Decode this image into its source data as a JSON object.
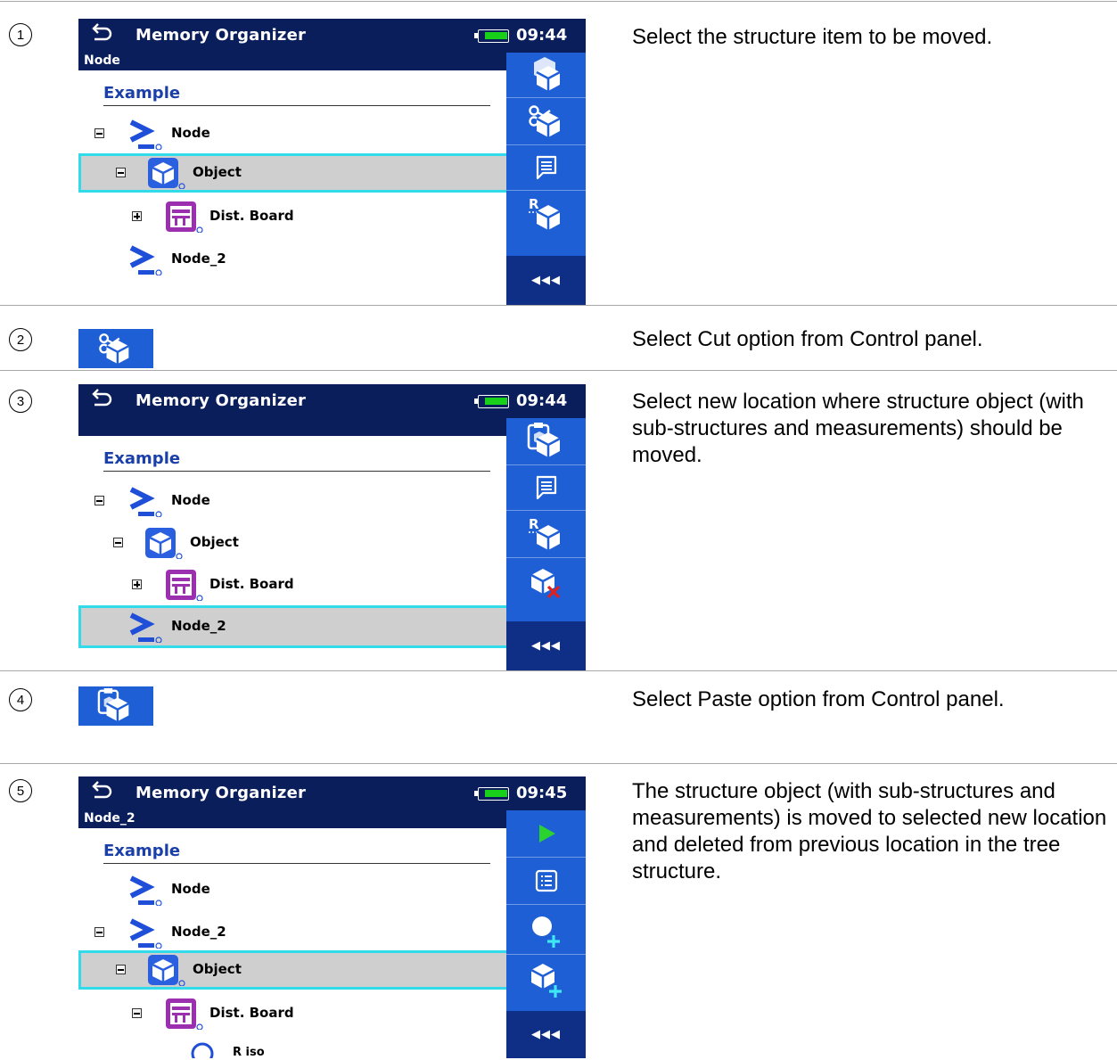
{
  "step_numbers": [
    "1",
    "2",
    "3",
    "4",
    "5"
  ],
  "descriptions": [
    "Select the structure item to be moved.",
    "Select Cut option from Control panel.",
    "Select new location where structure object (with sub-structures and measurements) should be moved.",
    "Select Paste option from Control panel.",
    "The structure object (with sub-structures and measurements) is moved to selected new location and deleted from previous location in the tree structure."
  ],
  "screens": [
    {
      "title": "Memory Organizer",
      "time": "09:44",
      "subtitle": "Node",
      "root": "Example",
      "nodes": [
        "Node",
        "Object",
        "Dist. Board",
        "Node_2"
      ]
    },
    {
      "title": "Memory Organizer",
      "time": "09:44",
      "subtitle": "",
      "root": "Example",
      "nodes": [
        "Node",
        "Object",
        "Dist. Board",
        "Node_2"
      ]
    },
    {
      "title": "Memory Organizer",
      "time": "09:45",
      "subtitle": "Node_2",
      "root": "Example",
      "nodes": [
        "Node",
        "Node_2",
        "Object",
        "Dist. Board",
        "R iso"
      ]
    }
  ],
  "more_label": "◀◀◀",
  "accent": "#1f5fd6",
  "selection_border": "#31dbe9"
}
